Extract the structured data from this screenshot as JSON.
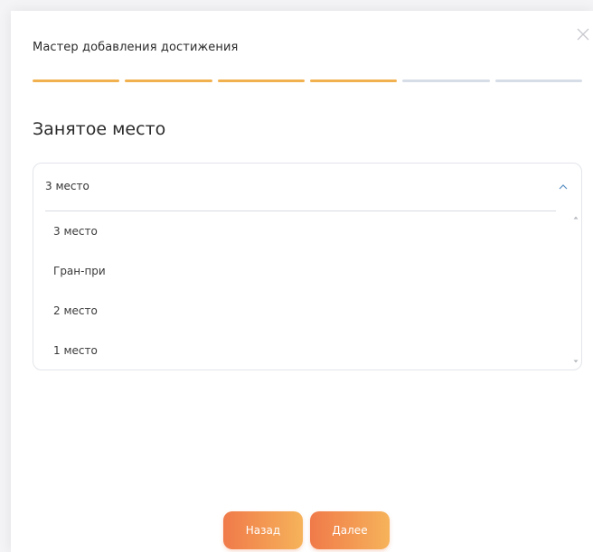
{
  "wizard": {
    "title": "Мастер добавления достижения",
    "steps_total": 6,
    "steps_completed": 4,
    "colors": {
      "step_done": "#f2b14f",
      "step_todo": "#d7dde6"
    }
  },
  "field": {
    "heading": "Занятое место",
    "selected_value": "3 место",
    "options": [
      "3 место",
      "Гран-при",
      "2 место",
      "1 место"
    ]
  },
  "buttons": {
    "back_label": "Назад",
    "next_label": "Далее",
    "colors": {
      "gradient_start": "#f07a4a",
      "gradient_end": "#f6b35a"
    }
  },
  "icons": {
    "close": "close-icon",
    "chevron": "chevron-up-icon"
  }
}
